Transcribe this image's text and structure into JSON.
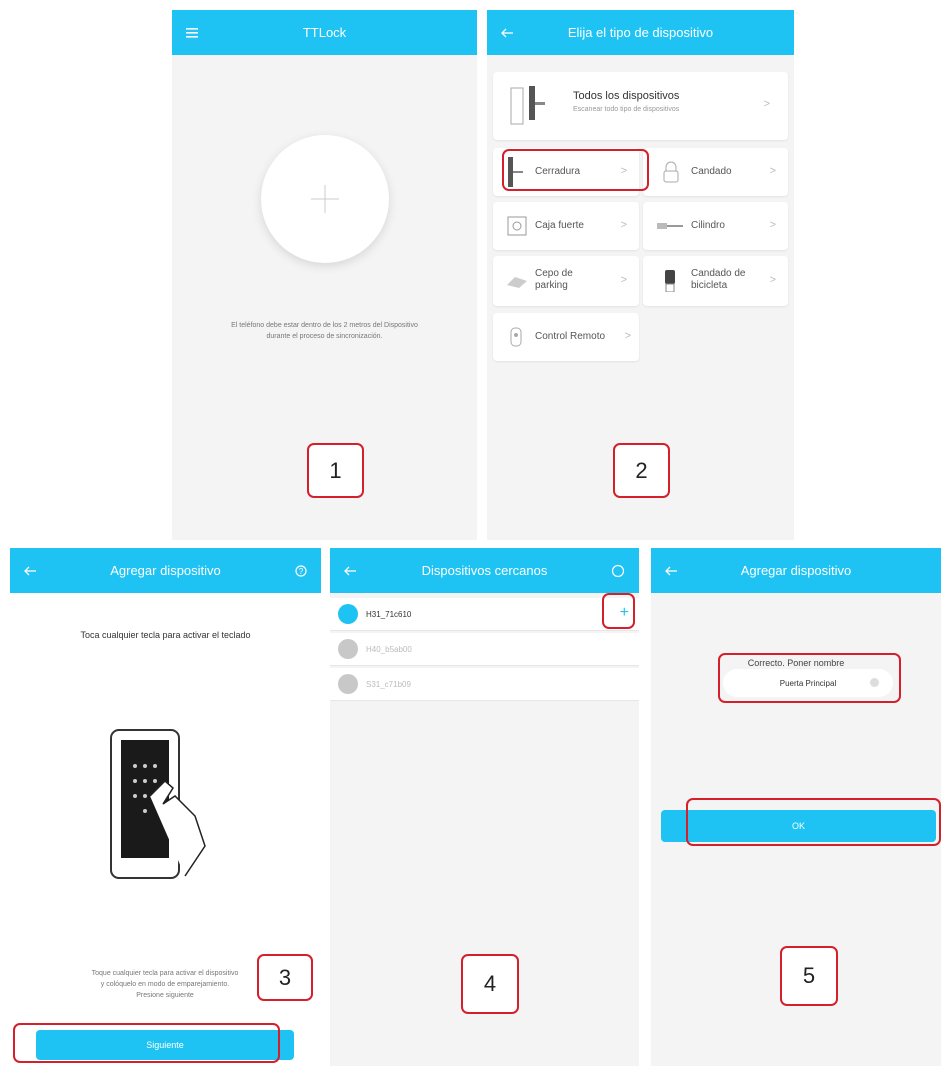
{
  "screen1": {
    "title": "TTLock",
    "info_line1": "El teléfono debe estar dentro de los 2 metros del Dispositivo",
    "info_line2": "durante el proceso de sincronización.",
    "step": "1"
  },
  "screen2": {
    "title": "Elija el tipo de dispositivo",
    "all_title": "Todos los dispositivos",
    "all_sub": "Escanear todo tipo de dispositivos",
    "items": [
      {
        "label": "Cerradura"
      },
      {
        "label": "Candado"
      },
      {
        "label": "Caja fuerte"
      },
      {
        "label": "Cilindro"
      },
      {
        "label": "Cepo de parking"
      },
      {
        "label": "Candado de bicicleta"
      },
      {
        "label": "Control Remoto"
      }
    ],
    "step": "2"
  },
  "screen3": {
    "title": "Agregar dispositivo",
    "heading": "Toca cualquier tecla para activar el teclado",
    "instr1": "Toque cualquier tecla para activar el dispositivo",
    "instr2": "y colóquelo en modo de emparejamiento.",
    "instr3": "Presione siguiente",
    "button": "Siguiente",
    "step": "3"
  },
  "screen4": {
    "title": "Dispositivos cercanos",
    "devices": [
      {
        "name": "H31_71c610"
      },
      {
        "name": "H40_b5ab00"
      },
      {
        "name": "S31_c71b09"
      }
    ],
    "step": "4"
  },
  "screen5": {
    "title": "Agregar dispositivo",
    "prompt": "Correcto. Poner nombre",
    "name_value": "Puerta Principal",
    "button": "OK",
    "step": "5"
  },
  "colors": {
    "accent": "#1ec3f3",
    "highlight": "#d4202a"
  }
}
